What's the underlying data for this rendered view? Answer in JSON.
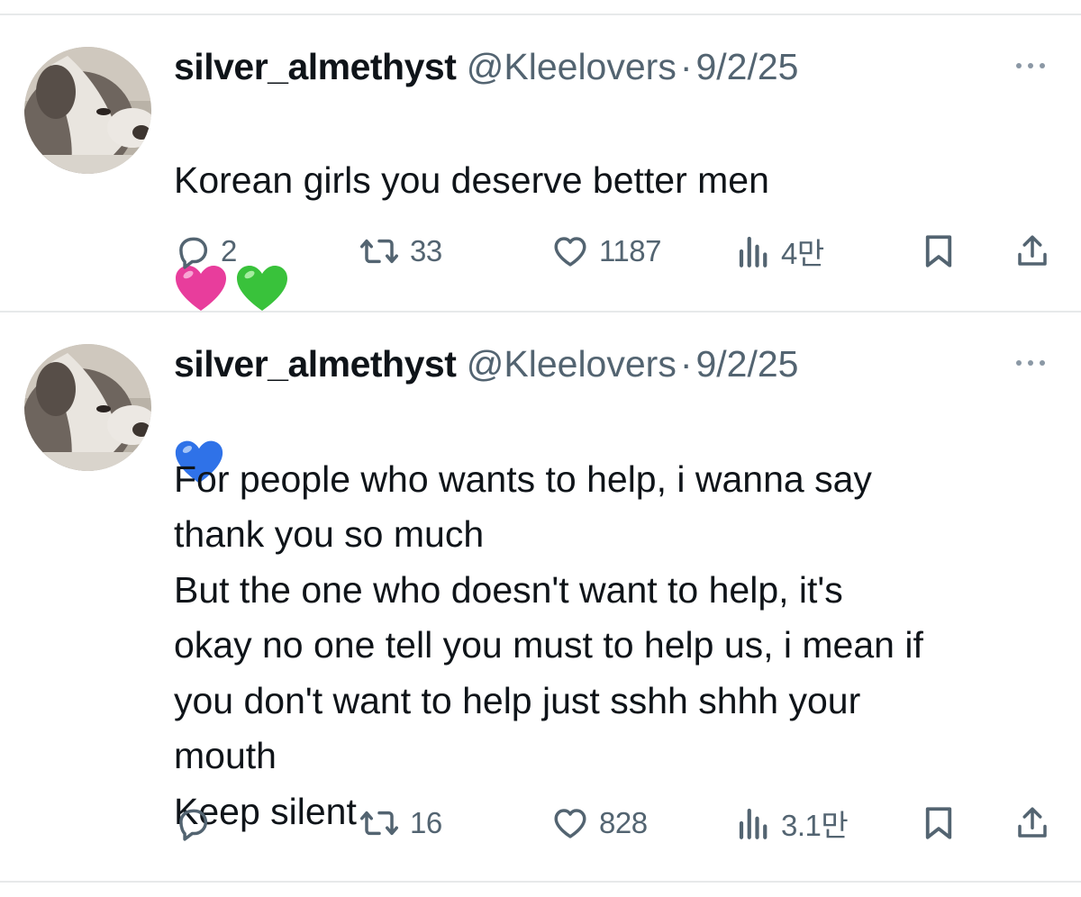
{
  "tweets": [
    {
      "display_name": "silver_almethyst",
      "handle": "@Kleelovers",
      "separator": "·",
      "date": "9/2/25",
      "text": "Korean girls you deserve better men",
      "emojis": [
        "pink-heart",
        "green-heart",
        "blue-heart"
      ],
      "replies": "2",
      "reposts": "33",
      "likes": "1187",
      "views": "4만"
    },
    {
      "display_name": "silver_almethyst",
      "handle": "@Kleelovers",
      "separator": "·",
      "date": "9/2/25",
      "text": "For people who wants to help, i wanna say\nthank you so much\nBut the one who doesn't want to help, it's\nokay no one tell you must to help us, i mean if\nyou don't want to help just sshh shhh your\nmouth\nKeep silent",
      "emojis": [],
      "replies": "",
      "reposts": "16",
      "likes": "828",
      "views": "3.1만"
    }
  ],
  "colors": {
    "text": "#0f1419",
    "secondary": "#536471",
    "divider": "#e7e9ea",
    "pink_heart": "#e83d9c",
    "green_heart": "#39c23b",
    "blue_heart": "#2f72e8"
  },
  "icons": [
    "reply-icon",
    "repost-icon",
    "like-icon",
    "views-icon",
    "bookmark-icon",
    "share-icon",
    "more-icon"
  ]
}
